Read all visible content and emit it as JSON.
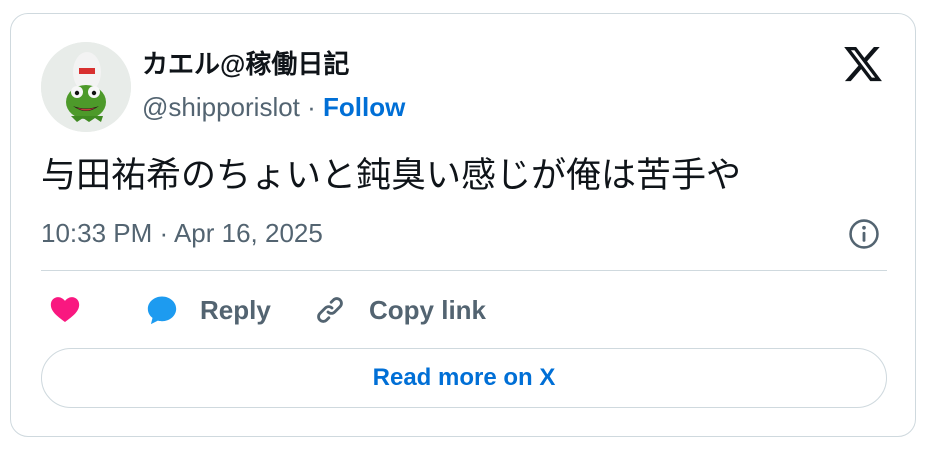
{
  "tweet": {
    "author": {
      "display_name": "カエル@稼働日記",
      "handle": "@shipporislot",
      "separator": "·",
      "follow_label": "Follow",
      "avatar_icon": "kermit-frog-avatar"
    },
    "text": "与田祐希のちょいと鈍臭い感じが俺は苦手や",
    "timestamp": "10:33 PM · Apr 16, 2025",
    "actions": {
      "like_icon": "heart-icon",
      "reply_label": "Reply",
      "reply_icon": "speech-bubble-icon",
      "copy_link_label": "Copy link",
      "copy_link_icon": "link-icon"
    },
    "read_more_label": "Read more on X"
  },
  "colors": {
    "like": "#f91880",
    "reply_icon": "#1d9bf0",
    "link_blue": "#006fd6",
    "secondary_text": "#536471",
    "border": "#cfd9de"
  }
}
